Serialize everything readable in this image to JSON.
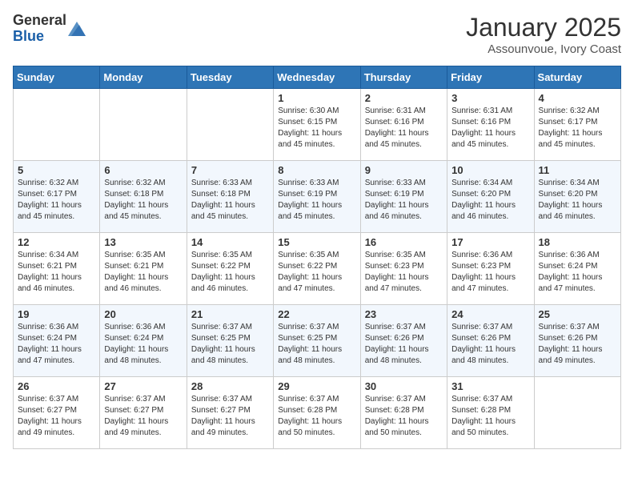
{
  "logo": {
    "general": "General",
    "blue": "Blue"
  },
  "header": {
    "title": "January 2025",
    "subtitle": "Assounvoue, Ivory Coast"
  },
  "weekdays": [
    "Sunday",
    "Monday",
    "Tuesday",
    "Wednesday",
    "Thursday",
    "Friday",
    "Saturday"
  ],
  "weeks": [
    [
      {
        "day": "",
        "info": ""
      },
      {
        "day": "",
        "info": ""
      },
      {
        "day": "",
        "info": ""
      },
      {
        "day": "1",
        "info": "Sunrise: 6:30 AM\nSunset: 6:15 PM\nDaylight: 11 hours and 45 minutes."
      },
      {
        "day": "2",
        "info": "Sunrise: 6:31 AM\nSunset: 6:16 PM\nDaylight: 11 hours and 45 minutes."
      },
      {
        "day": "3",
        "info": "Sunrise: 6:31 AM\nSunset: 6:16 PM\nDaylight: 11 hours and 45 minutes."
      },
      {
        "day": "4",
        "info": "Sunrise: 6:32 AM\nSunset: 6:17 PM\nDaylight: 11 hours and 45 minutes."
      }
    ],
    [
      {
        "day": "5",
        "info": "Sunrise: 6:32 AM\nSunset: 6:17 PM\nDaylight: 11 hours and 45 minutes."
      },
      {
        "day": "6",
        "info": "Sunrise: 6:32 AM\nSunset: 6:18 PM\nDaylight: 11 hours and 45 minutes."
      },
      {
        "day": "7",
        "info": "Sunrise: 6:33 AM\nSunset: 6:18 PM\nDaylight: 11 hours and 45 minutes."
      },
      {
        "day": "8",
        "info": "Sunrise: 6:33 AM\nSunset: 6:19 PM\nDaylight: 11 hours and 45 minutes."
      },
      {
        "day": "9",
        "info": "Sunrise: 6:33 AM\nSunset: 6:19 PM\nDaylight: 11 hours and 46 minutes."
      },
      {
        "day": "10",
        "info": "Sunrise: 6:34 AM\nSunset: 6:20 PM\nDaylight: 11 hours and 46 minutes."
      },
      {
        "day": "11",
        "info": "Sunrise: 6:34 AM\nSunset: 6:20 PM\nDaylight: 11 hours and 46 minutes."
      }
    ],
    [
      {
        "day": "12",
        "info": "Sunrise: 6:34 AM\nSunset: 6:21 PM\nDaylight: 11 hours and 46 minutes."
      },
      {
        "day": "13",
        "info": "Sunrise: 6:35 AM\nSunset: 6:21 PM\nDaylight: 11 hours and 46 minutes."
      },
      {
        "day": "14",
        "info": "Sunrise: 6:35 AM\nSunset: 6:22 PM\nDaylight: 11 hours and 46 minutes."
      },
      {
        "day": "15",
        "info": "Sunrise: 6:35 AM\nSunset: 6:22 PM\nDaylight: 11 hours and 47 minutes."
      },
      {
        "day": "16",
        "info": "Sunrise: 6:35 AM\nSunset: 6:23 PM\nDaylight: 11 hours and 47 minutes."
      },
      {
        "day": "17",
        "info": "Sunrise: 6:36 AM\nSunset: 6:23 PM\nDaylight: 11 hours and 47 minutes."
      },
      {
        "day": "18",
        "info": "Sunrise: 6:36 AM\nSunset: 6:24 PM\nDaylight: 11 hours and 47 minutes."
      }
    ],
    [
      {
        "day": "19",
        "info": "Sunrise: 6:36 AM\nSunset: 6:24 PM\nDaylight: 11 hours and 47 minutes."
      },
      {
        "day": "20",
        "info": "Sunrise: 6:36 AM\nSunset: 6:24 PM\nDaylight: 11 hours and 48 minutes."
      },
      {
        "day": "21",
        "info": "Sunrise: 6:37 AM\nSunset: 6:25 PM\nDaylight: 11 hours and 48 minutes."
      },
      {
        "day": "22",
        "info": "Sunrise: 6:37 AM\nSunset: 6:25 PM\nDaylight: 11 hours and 48 minutes."
      },
      {
        "day": "23",
        "info": "Sunrise: 6:37 AM\nSunset: 6:26 PM\nDaylight: 11 hours and 48 minutes."
      },
      {
        "day": "24",
        "info": "Sunrise: 6:37 AM\nSunset: 6:26 PM\nDaylight: 11 hours and 48 minutes."
      },
      {
        "day": "25",
        "info": "Sunrise: 6:37 AM\nSunset: 6:26 PM\nDaylight: 11 hours and 49 minutes."
      }
    ],
    [
      {
        "day": "26",
        "info": "Sunrise: 6:37 AM\nSunset: 6:27 PM\nDaylight: 11 hours and 49 minutes."
      },
      {
        "day": "27",
        "info": "Sunrise: 6:37 AM\nSunset: 6:27 PM\nDaylight: 11 hours and 49 minutes."
      },
      {
        "day": "28",
        "info": "Sunrise: 6:37 AM\nSunset: 6:27 PM\nDaylight: 11 hours and 49 minutes."
      },
      {
        "day": "29",
        "info": "Sunrise: 6:37 AM\nSunset: 6:28 PM\nDaylight: 11 hours and 50 minutes."
      },
      {
        "day": "30",
        "info": "Sunrise: 6:37 AM\nSunset: 6:28 PM\nDaylight: 11 hours and 50 minutes."
      },
      {
        "day": "31",
        "info": "Sunrise: 6:37 AM\nSunset: 6:28 PM\nDaylight: 11 hours and 50 minutes."
      },
      {
        "day": "",
        "info": ""
      }
    ]
  ]
}
